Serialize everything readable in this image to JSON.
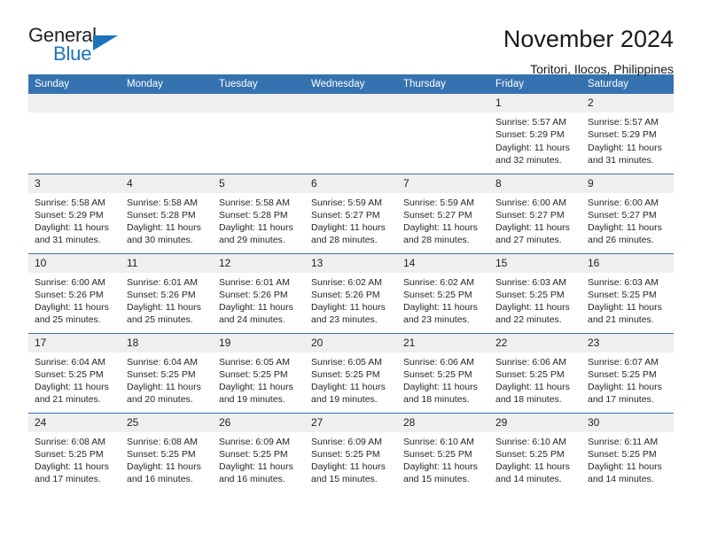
{
  "brand": {
    "name_part1": "General",
    "name_part2": "Blue",
    "accent_color": "#1b74bb",
    "logo_icon": "triangle-flag-icon"
  },
  "header": {
    "title": "November 2024",
    "location": "Toritori, Ilocos, Philippines"
  },
  "theme": {
    "header_blue": "#3572b0",
    "daynum_band": "#efefef",
    "text": "#262626"
  },
  "calendar": {
    "weekday_headers": [
      "Sunday",
      "Monday",
      "Tuesday",
      "Wednesday",
      "Thursday",
      "Friday",
      "Saturday"
    ],
    "labels": {
      "sunrise_prefix": "Sunrise:",
      "sunset_prefix": "Sunset:",
      "daylight_prefix": "Daylight:"
    },
    "weeks": [
      [
        {
          "day": "",
          "empty": true
        },
        {
          "day": "",
          "empty": true
        },
        {
          "day": "",
          "empty": true
        },
        {
          "day": "",
          "empty": true
        },
        {
          "day": "",
          "empty": true
        },
        {
          "day": "1",
          "sunrise": "Sunrise: 5:57 AM",
          "sunset": "Sunset: 5:29 PM",
          "daylight_line1": "Daylight: 11 hours",
          "daylight_line2": "and 32 minutes."
        },
        {
          "day": "2",
          "sunrise": "Sunrise: 5:57 AM",
          "sunset": "Sunset: 5:29 PM",
          "daylight_line1": "Daylight: 11 hours",
          "daylight_line2": "and 31 minutes."
        }
      ],
      [
        {
          "day": "3",
          "sunrise": "Sunrise: 5:58 AM",
          "sunset": "Sunset: 5:29 PM",
          "daylight_line1": "Daylight: 11 hours",
          "daylight_line2": "and 31 minutes."
        },
        {
          "day": "4",
          "sunrise": "Sunrise: 5:58 AM",
          "sunset": "Sunset: 5:28 PM",
          "daylight_line1": "Daylight: 11 hours",
          "daylight_line2": "and 30 minutes."
        },
        {
          "day": "5",
          "sunrise": "Sunrise: 5:58 AM",
          "sunset": "Sunset: 5:28 PM",
          "daylight_line1": "Daylight: 11 hours",
          "daylight_line2": "and 29 minutes."
        },
        {
          "day": "6",
          "sunrise": "Sunrise: 5:59 AM",
          "sunset": "Sunset: 5:27 PM",
          "daylight_line1": "Daylight: 11 hours",
          "daylight_line2": "and 28 minutes."
        },
        {
          "day": "7",
          "sunrise": "Sunrise: 5:59 AM",
          "sunset": "Sunset: 5:27 PM",
          "daylight_line1": "Daylight: 11 hours",
          "daylight_line2": "and 28 minutes."
        },
        {
          "day": "8",
          "sunrise": "Sunrise: 6:00 AM",
          "sunset": "Sunset: 5:27 PM",
          "daylight_line1": "Daylight: 11 hours",
          "daylight_line2": "and 27 minutes."
        },
        {
          "day": "9",
          "sunrise": "Sunrise: 6:00 AM",
          "sunset": "Sunset: 5:27 PM",
          "daylight_line1": "Daylight: 11 hours",
          "daylight_line2": "and 26 minutes."
        }
      ],
      [
        {
          "day": "10",
          "sunrise": "Sunrise: 6:00 AM",
          "sunset": "Sunset: 5:26 PM",
          "daylight_line1": "Daylight: 11 hours",
          "daylight_line2": "and 25 minutes."
        },
        {
          "day": "11",
          "sunrise": "Sunrise: 6:01 AM",
          "sunset": "Sunset: 5:26 PM",
          "daylight_line1": "Daylight: 11 hours",
          "daylight_line2": "and 25 minutes."
        },
        {
          "day": "12",
          "sunrise": "Sunrise: 6:01 AM",
          "sunset": "Sunset: 5:26 PM",
          "daylight_line1": "Daylight: 11 hours",
          "daylight_line2": "and 24 minutes."
        },
        {
          "day": "13",
          "sunrise": "Sunrise: 6:02 AM",
          "sunset": "Sunset: 5:26 PM",
          "daylight_line1": "Daylight: 11 hours",
          "daylight_line2": "and 23 minutes."
        },
        {
          "day": "14",
          "sunrise": "Sunrise: 6:02 AM",
          "sunset": "Sunset: 5:25 PM",
          "daylight_line1": "Daylight: 11 hours",
          "daylight_line2": "and 23 minutes."
        },
        {
          "day": "15",
          "sunrise": "Sunrise: 6:03 AM",
          "sunset": "Sunset: 5:25 PM",
          "daylight_line1": "Daylight: 11 hours",
          "daylight_line2": "and 22 minutes."
        },
        {
          "day": "16",
          "sunrise": "Sunrise: 6:03 AM",
          "sunset": "Sunset: 5:25 PM",
          "daylight_line1": "Daylight: 11 hours",
          "daylight_line2": "and 21 minutes."
        }
      ],
      [
        {
          "day": "17",
          "sunrise": "Sunrise: 6:04 AM",
          "sunset": "Sunset: 5:25 PM",
          "daylight_line1": "Daylight: 11 hours",
          "daylight_line2": "and 21 minutes."
        },
        {
          "day": "18",
          "sunrise": "Sunrise: 6:04 AM",
          "sunset": "Sunset: 5:25 PM",
          "daylight_line1": "Daylight: 11 hours",
          "daylight_line2": "and 20 minutes."
        },
        {
          "day": "19",
          "sunrise": "Sunrise: 6:05 AM",
          "sunset": "Sunset: 5:25 PM",
          "daylight_line1": "Daylight: 11 hours",
          "daylight_line2": "and 19 minutes."
        },
        {
          "day": "20",
          "sunrise": "Sunrise: 6:05 AM",
          "sunset": "Sunset: 5:25 PM",
          "daylight_line1": "Daylight: 11 hours",
          "daylight_line2": "and 19 minutes."
        },
        {
          "day": "21",
          "sunrise": "Sunrise: 6:06 AM",
          "sunset": "Sunset: 5:25 PM",
          "daylight_line1": "Daylight: 11 hours",
          "daylight_line2": "and 18 minutes."
        },
        {
          "day": "22",
          "sunrise": "Sunrise: 6:06 AM",
          "sunset": "Sunset: 5:25 PM",
          "daylight_line1": "Daylight: 11 hours",
          "daylight_line2": "and 18 minutes."
        },
        {
          "day": "23",
          "sunrise": "Sunrise: 6:07 AM",
          "sunset": "Sunset: 5:25 PM",
          "daylight_line1": "Daylight: 11 hours",
          "daylight_line2": "and 17 minutes."
        }
      ],
      [
        {
          "day": "24",
          "sunrise": "Sunrise: 6:08 AM",
          "sunset": "Sunset: 5:25 PM",
          "daylight_line1": "Daylight: 11 hours",
          "daylight_line2": "and 17 minutes."
        },
        {
          "day": "25",
          "sunrise": "Sunrise: 6:08 AM",
          "sunset": "Sunset: 5:25 PM",
          "daylight_line1": "Daylight: 11 hours",
          "daylight_line2": "and 16 minutes."
        },
        {
          "day": "26",
          "sunrise": "Sunrise: 6:09 AM",
          "sunset": "Sunset: 5:25 PM",
          "daylight_line1": "Daylight: 11 hours",
          "daylight_line2": "and 16 minutes."
        },
        {
          "day": "27",
          "sunrise": "Sunrise: 6:09 AM",
          "sunset": "Sunset: 5:25 PM",
          "daylight_line1": "Daylight: 11 hours",
          "daylight_line2": "and 15 minutes."
        },
        {
          "day": "28",
          "sunrise": "Sunrise: 6:10 AM",
          "sunset": "Sunset: 5:25 PM",
          "daylight_line1": "Daylight: 11 hours",
          "daylight_line2": "and 15 minutes."
        },
        {
          "day": "29",
          "sunrise": "Sunrise: 6:10 AM",
          "sunset": "Sunset: 5:25 PM",
          "daylight_line1": "Daylight: 11 hours",
          "daylight_line2": "and 14 minutes."
        },
        {
          "day": "30",
          "sunrise": "Sunrise: 6:11 AM",
          "sunset": "Sunset: 5:25 PM",
          "daylight_line1": "Daylight: 11 hours",
          "daylight_line2": "and 14 minutes."
        }
      ]
    ]
  }
}
